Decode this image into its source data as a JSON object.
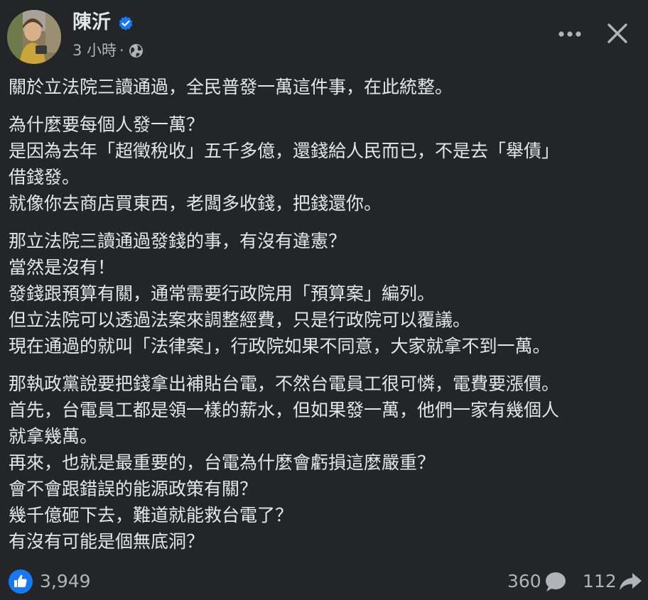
{
  "post": {
    "author": "陳沂",
    "time": "3 小時",
    "dot": "·",
    "paragraphs": [
      [
        "關於立法院三讀通過，全民普發一萬這件事，在此統整。"
      ],
      [
        "為什麼要每個人發一萬？",
        "是因為去年「超徵稅收」五千多億，還錢給人民而已，不是去「舉債」",
        "借錢發。",
        "就像你去商店買東西，老闆多收錢，把錢還你。"
      ],
      [
        "那立法院三讀通過發錢的事，有沒有違憲？",
        "當然是沒有！",
        "發錢跟預算有關，通常需要行政院用「預算案」編列。",
        "但立法院可以透過法案來調整經費，只是行政院可以覆議。",
        "現在通過的就叫「法律案」，行政院如果不同意，大家就拿不到一萬。"
      ],
      [
        "那執政黨說要把錢拿出補貼台電，不然台電員工很可憐，電費要漲價。",
        "首先，台電員工都是領一樣的薪水，但如果發一萬，他們一家有幾個人",
        "就拿幾萬。",
        "再來，也就是最重要的，台電為什麼會虧損這麼嚴重？",
        "會不會跟錯誤的能源政策有關？",
        "幾千億砸下去，難道就能救台電了？",
        "有沒有可能是個無底洞？"
      ]
    ]
  },
  "footer": {
    "likes": "3,949",
    "comments": "360",
    "shares": "112"
  },
  "colors": {
    "background": "#242526",
    "text": "#e4e6eb",
    "secondary": "#b0b3b8",
    "accent": "#1877f2"
  },
  "icons": [
    "verified-badge",
    "globe",
    "more-dots",
    "close-x",
    "like-thumb",
    "comment-bubble",
    "share-arrow"
  ]
}
